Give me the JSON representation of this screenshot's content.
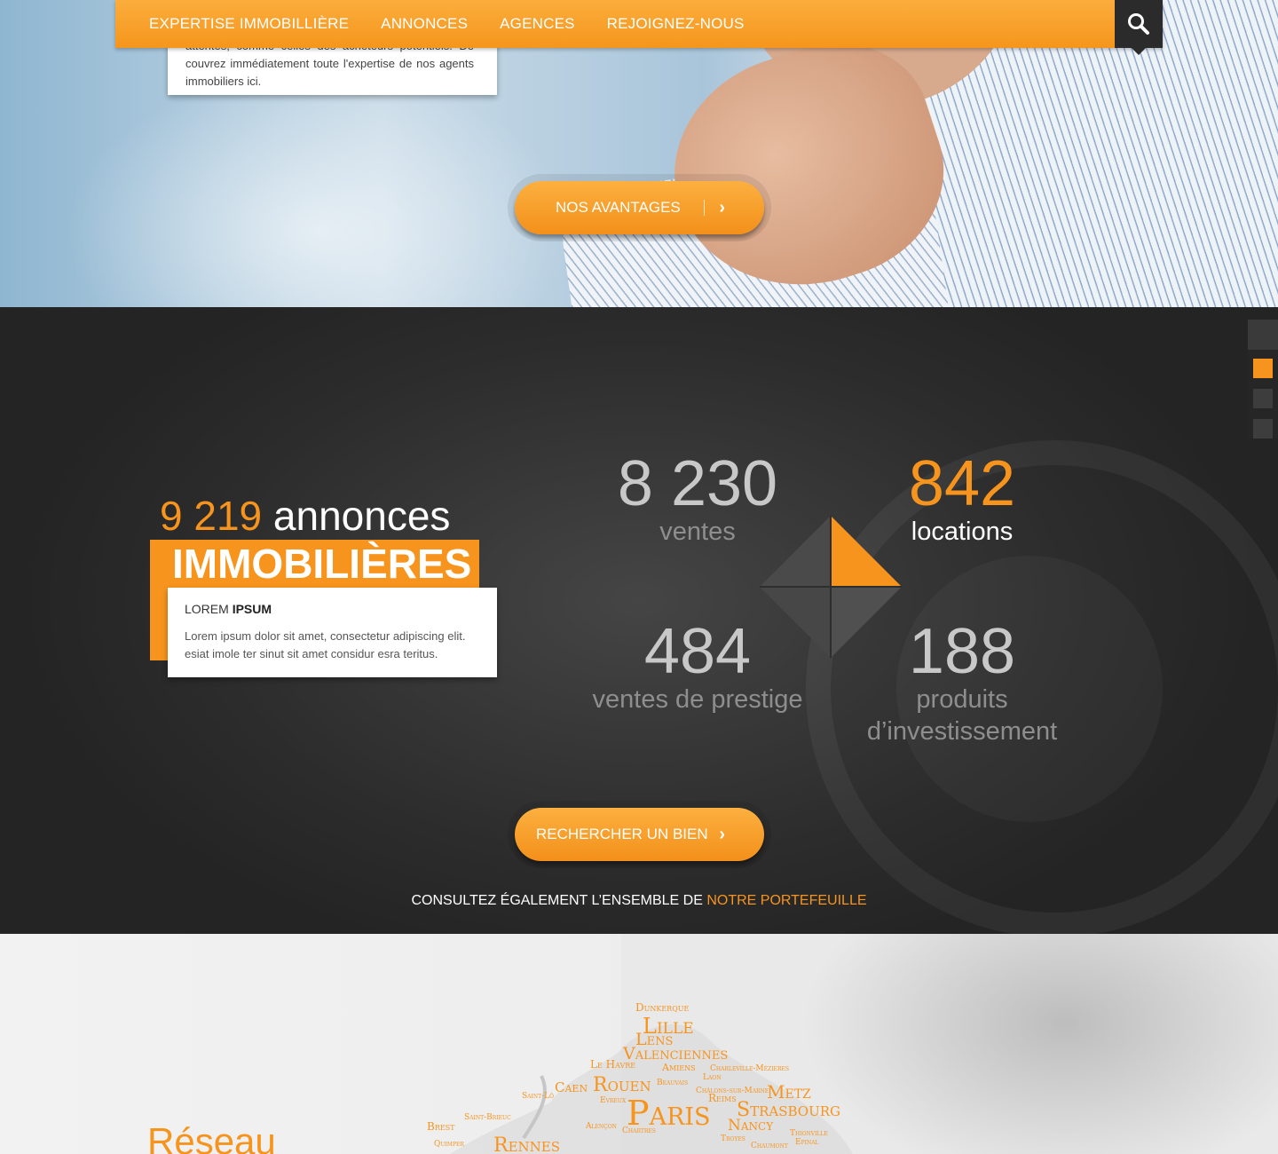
{
  "nav": {
    "items": [
      "EXPERTISE IMMOBILLIÈRE",
      "ANNONCES",
      "AGENCES",
      "REJOIGNEZ-NOUS"
    ]
  },
  "hero": {
    "card_text": "attentes, comme celles des acheteurs potentiels. Dé couvrez immédiatement toute l'expertise de nos agents immobiliers ici.",
    "button_label": "NOS AVANTAGES"
  },
  "stats_section": {
    "count": "9 219",
    "count_suffix": "annonces",
    "title": "IMMOBILIÈRES",
    "card_title_light": "LOREM",
    "card_title_bold": "IPSUM",
    "card_text": "Lorem ipsum dolor sit amet, consectetur adipiscing elit. esiat imole ter sinut sit amet considur esra teritus.",
    "stats": [
      {
        "value": "8 230",
        "label": "ventes"
      },
      {
        "value": "842",
        "label": "locations"
      },
      {
        "value": "484",
        "label": "ventes de prestige"
      },
      {
        "value": "188",
        "label": "produits d’investissement"
      }
    ],
    "button_label": "RECHERCHER UN BIEN",
    "portfolio_prefix": "CONSULTEZ ÉGALEMENT L’ENSEMBLE DE",
    "portfolio_link": "NOTRE PORTEFEUILLE",
    "accent_color": "#f7941d"
  },
  "network": {
    "title": "Réseau",
    "cities": [
      "Dunkerque",
      "Lille",
      "Lens",
      "Valenciennes",
      "Le Havre",
      "Amiens",
      "Charleville-Mézieres",
      "Laon",
      "Caen",
      "Rouen",
      "Beauvais",
      "Châlons-sur-Marne",
      "Metz",
      "Saint-Lô",
      "Evreux",
      "Reims",
      "Paris",
      "Strasbourg",
      "Saint-Brieuc",
      "Nancy",
      "Brest",
      "Alençon",
      "Chartres",
      "Troyes",
      "Thionville",
      "Epinal",
      "Quimper",
      "Rennes",
      "Chaumont"
    ]
  }
}
